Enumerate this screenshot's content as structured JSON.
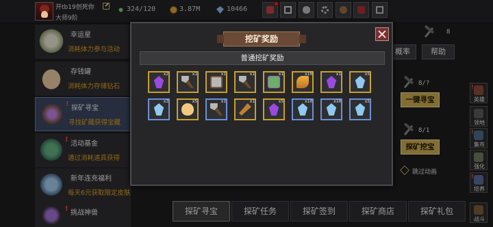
{
  "topbar": {
    "player_name": "开tb19创死你",
    "player_title": "大师9阶",
    "stamina": "324/120",
    "gold": "3.87M",
    "gems": "10466"
  },
  "activities": [
    {
      "name": "幸运星",
      "desc": "消耗体力参与活动"
    },
    {
      "name": "存钱罐",
      "desc": "消耗体力存储钻石"
    },
    {
      "name": "探矿寻宝",
      "desc": "寻找矿藏获得宝藏"
    },
    {
      "name": "活动基金",
      "desc": "通过消耗道具获得"
    },
    {
      "name": "新年连充福利",
      "desc": "每天6元获取限定皮肤"
    },
    {
      "name": "挑战神兽",
      "desc": ""
    }
  ],
  "right": {
    "pick_count_top": "8",
    "prob_label": "概率",
    "help_label": "帮助",
    "seek_count": "8/?",
    "seek_button": "一键寻宝",
    "dig_count": "8/1",
    "dig_button": "探矿挖宝",
    "skip_label": "跳过动画"
  },
  "side_buttons": [
    "英雄",
    "领地",
    "集市",
    "强化",
    "培养",
    "战斗"
  ],
  "bottom_tabs": [
    "探矿寻宝",
    "探矿任务",
    "探矿签到",
    "探矿商店",
    "探矿礼包"
  ],
  "modal": {
    "title": "挖矿奖励",
    "subheader": "普通挖矿奖励",
    "rewards": [
      {
        "icon": "purple-crystal-icon",
        "qty": "x2",
        "frame": "gold"
      },
      {
        "icon": "hammer-icon",
        "qty": "x1",
        "frame": "gold"
      },
      {
        "icon": "silver-chest-icon",
        "qty": "x1",
        "frame": "gold"
      },
      {
        "icon": "hammer-icon",
        "qty": "x1",
        "frame": "gold"
      },
      {
        "icon": "green-chest-icon",
        "qty": "x1",
        "frame": "gold"
      },
      {
        "icon": "feather-icon",
        "qty": "x10",
        "frame": "gold"
      },
      {
        "icon": "purple-crystal-icon",
        "qty": "x1",
        "frame": "gold"
      },
      {
        "icon": "blue-crystal-icon",
        "qty": "x5",
        "frame": "gold"
      },
      {
        "icon": "blue-crystal-icon",
        "qty": "x3",
        "frame": "blue"
      },
      {
        "icon": "egg-icon",
        "qty": "x5",
        "frame": "gold"
      },
      {
        "icon": "hammer-icon",
        "qty": "x1",
        "frame": "blue"
      },
      {
        "icon": "staff-icon",
        "qty": "x1",
        "frame": "gold"
      },
      {
        "icon": "purple-crystal-icon",
        "qty": "x5",
        "frame": "gold"
      },
      {
        "icon": "blue-crystal-icon",
        "qty": "x10",
        "frame": "blue"
      },
      {
        "icon": "blue-crystal-icon",
        "qty": "x10",
        "frame": "blue"
      },
      {
        "icon": "blue-crystal-icon",
        "qty": "x5",
        "frame": "blue"
      }
    ]
  },
  "colors": {
    "accent_gold": "#c8aa50",
    "warn_red": "#ff4a3a",
    "rare_blue": "#6a90d8"
  }
}
